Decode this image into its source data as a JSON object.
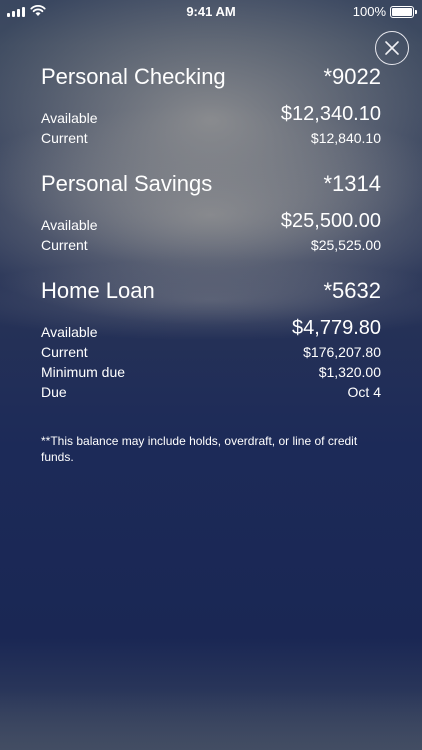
{
  "status_bar": {
    "time": "9:41 AM",
    "battery": "100%"
  },
  "close_button": {
    "icon": "close-icon"
  },
  "accounts": [
    {
      "name": "Personal Checking",
      "number": "*9022",
      "rows": [
        {
          "label": "Available",
          "value": "$12,340.10"
        },
        {
          "label": "Current",
          "value": "$12,840.10"
        }
      ]
    },
    {
      "name": "Personal Savings",
      "number": "*1314",
      "rows": [
        {
          "label": "Available",
          "value": "$25,500.00"
        },
        {
          "label": "Current",
          "value": "$25,525.00"
        }
      ]
    },
    {
      "name": "Home Loan",
      "number": "*5632",
      "rows": [
        {
          "label": "Available",
          "value": "$4,779.80"
        },
        {
          "label": "Current",
          "value": "$176,207.80"
        },
        {
          "label": "Minimum due",
          "value": "$1,320.00"
        },
        {
          "label": "Due",
          "value": "Oct 4"
        }
      ]
    }
  ],
  "footnote": "**This balance may include holds, overdraft, or line of credit funds."
}
